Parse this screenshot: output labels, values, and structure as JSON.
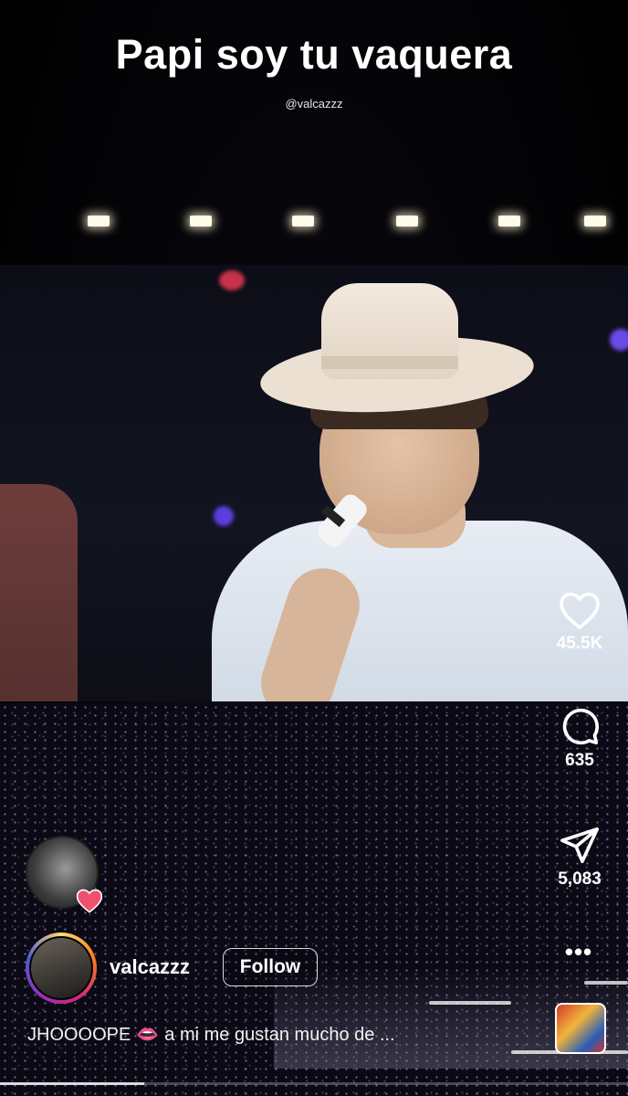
{
  "video": {
    "caption_title": "Papi soy tu vaquera",
    "caption_handle": "@valcazzz"
  },
  "actions": {
    "like_count": "45.5K",
    "comment_count": "635",
    "share_count": "5,083",
    "like_icon": "heart-icon",
    "comment_icon": "comment-bubble-icon",
    "share_icon": "send-icon",
    "more_icon": "more-dots-icon"
  },
  "author": {
    "username": "valcazzz",
    "follow_label": "Follow"
  },
  "post": {
    "caption_start": "JHOOOOPE",
    "caption_rest": "a mi me gustan mucho de ..."
  },
  "progress": {
    "fraction": 0.23
  },
  "colors": {
    "heart": "#f0506e",
    "progress": "#ffffff"
  }
}
